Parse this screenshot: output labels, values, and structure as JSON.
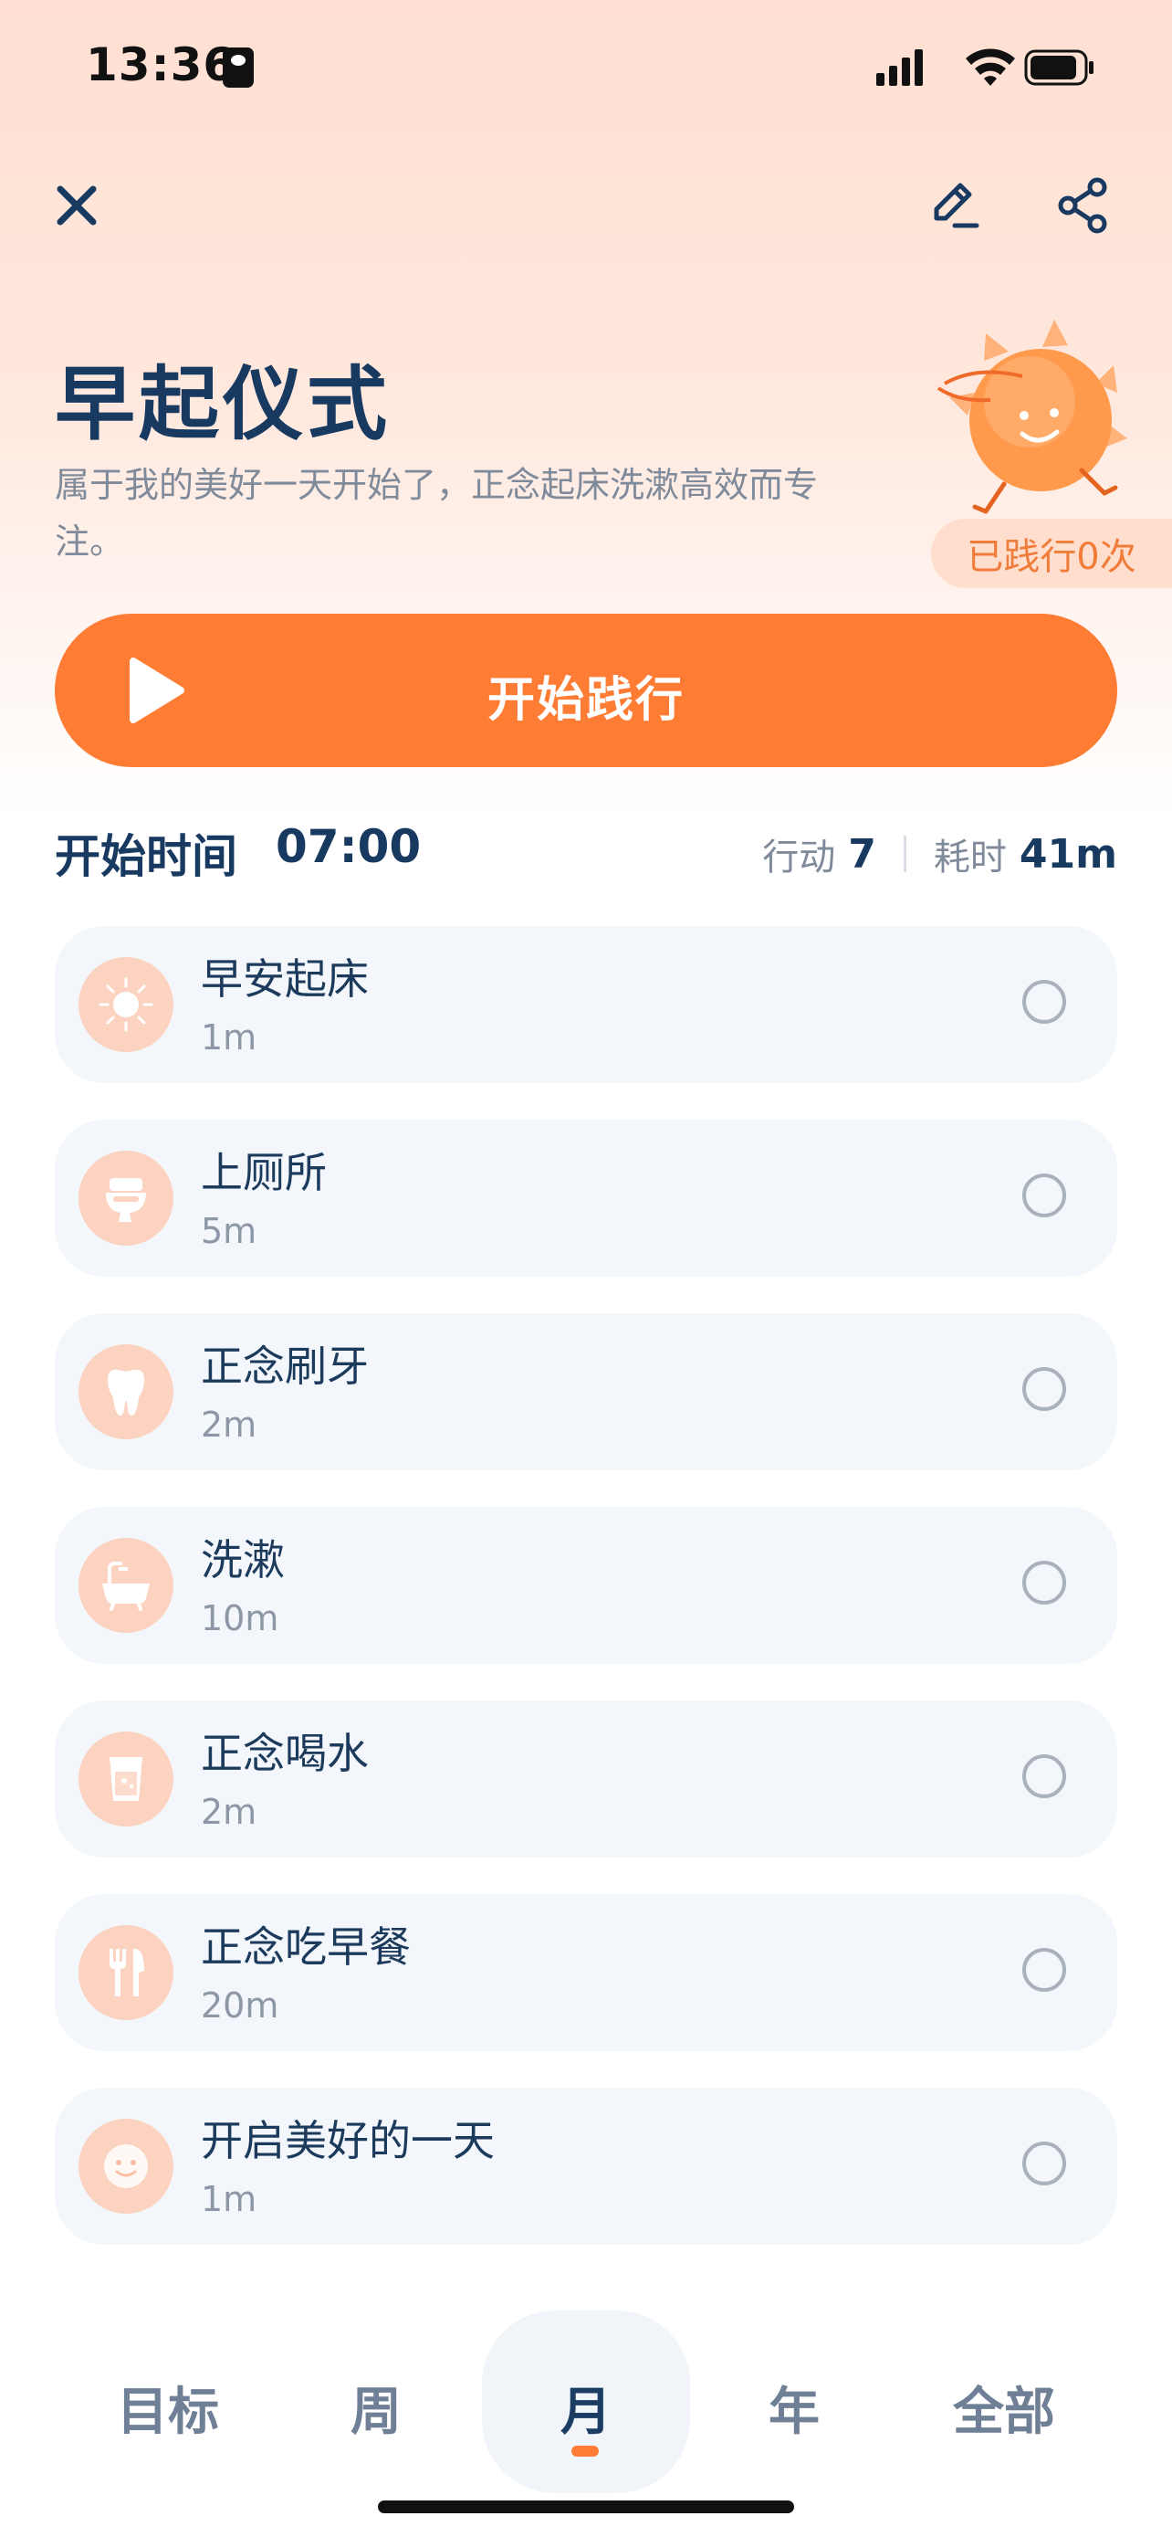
{
  "status_bar": {
    "time": "13:36"
  },
  "header": {
    "title": "早起仪式",
    "description": "属于我的美好一天开始了，正念起床洗漱高效而专注。",
    "practice_count": "已践行0次"
  },
  "start_button": {
    "label": "开始践行"
  },
  "meta": {
    "start_time_label": "开始时间",
    "start_time_value": "07:00",
    "actions_label": "行动",
    "actions_value": "7",
    "duration_label": "耗时",
    "duration_value": "41m"
  },
  "tasks": [
    {
      "name": "早安起床",
      "duration": "1m",
      "icon": "sun-icon"
    },
    {
      "name": "上厕所",
      "duration": "5m",
      "icon": "toilet-icon"
    },
    {
      "name": "正念刷牙",
      "duration": "2m",
      "icon": "tooth-icon"
    },
    {
      "name": "洗漱",
      "duration": "10m",
      "icon": "bathtub-icon"
    },
    {
      "name": "正念喝水",
      "duration": "2m",
      "icon": "water-glass-icon"
    },
    {
      "name": "正念吃早餐",
      "duration": "20m",
      "icon": "cutlery-icon"
    },
    {
      "name": "开启美好的一天",
      "duration": "1m",
      "icon": "smile-icon"
    }
  ],
  "tabs": [
    {
      "label": "目标",
      "active": false
    },
    {
      "label": "周",
      "active": false
    },
    {
      "label": "月",
      "active": true
    },
    {
      "label": "年",
      "active": false
    },
    {
      "label": "全部",
      "active": false
    }
  ],
  "colors": {
    "accent": "#ff7c34",
    "title": "#183a60",
    "card": "#f3f6fa",
    "icon_bg": "#fcd3c0"
  }
}
